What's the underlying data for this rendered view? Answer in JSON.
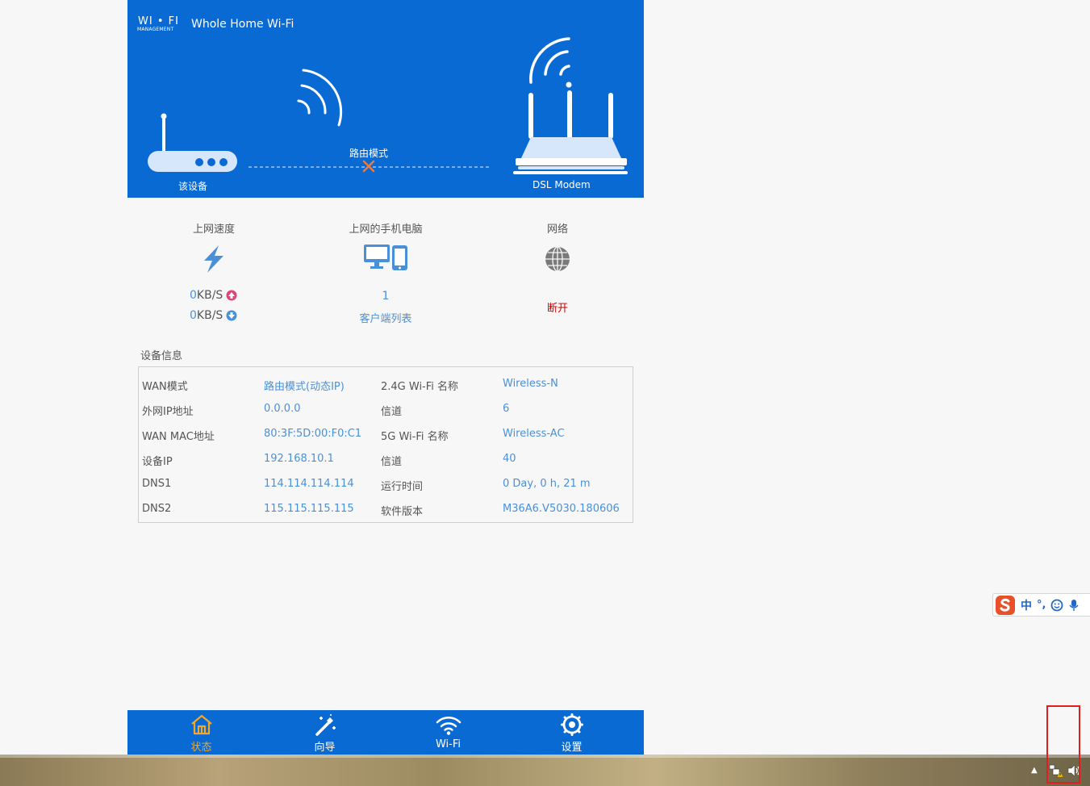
{
  "brand": {
    "logo_top": "WI • FI",
    "logo_sub": "MANAGEMENT",
    "title": "Whole Home Wi-Fi"
  },
  "topology": {
    "device_label": "该设备",
    "mode_label": "路由模式",
    "modem_label": "DSL Modem",
    "link_status": "disconnected"
  },
  "stats": {
    "speed": {
      "title": "上网速度",
      "up_value": "0",
      "down_value": "0",
      "unit": "KB/S"
    },
    "clients": {
      "title": "上网的手机电脑",
      "count": "1",
      "link": "客户端列表"
    },
    "network": {
      "title": "网络",
      "status": "断开"
    }
  },
  "device_info": {
    "title": "设备信息",
    "rows": [
      {
        "k1": "WAN模式",
        "v1": "路由模式(动态IP)",
        "k2": "2.4G Wi-Fi 名称",
        "v2": "Wireless-N"
      },
      {
        "k1": "外网IP地址",
        "v1": "0.0.0.0",
        "k2": "信道",
        "v2": "6"
      },
      {
        "k1": "WAN MAC地址",
        "v1": "80:3F:5D:00:F0:C1",
        "k2": "5G Wi-Fi 名称",
        "v2": "Wireless-AC"
      },
      {
        "k1": "设备IP",
        "v1": "192.168.10.1",
        "k2": "信道",
        "v2": "40"
      },
      {
        "k1": "DNS1",
        "v1": "114.114.114.114",
        "k2": "运行时间",
        "v2": "0 Day, 0 h, 21 m"
      },
      {
        "k1": "DNS2",
        "v1": "115.115.115.115",
        "k2": "软件版本",
        "v2": "M36A6.V5030.180606"
      }
    ]
  },
  "nav": {
    "items": [
      {
        "label": "状态",
        "icon": "home-icon",
        "active": true
      },
      {
        "label": "向导",
        "icon": "wand-icon",
        "active": false
      },
      {
        "label": "Wi-Fi",
        "icon": "wifi-icon",
        "active": false
      },
      {
        "label": "设置",
        "icon": "gear-icon",
        "active": false
      }
    ]
  },
  "ime": {
    "lang": "中",
    "punct": "°,"
  },
  "colors": {
    "primary": "#0a6ad4",
    "link": "#4a90d9",
    "active": "#f5a623",
    "error": "#cc0000",
    "upload_arrow": "#e0447a",
    "download_arrow": "#4a90d9"
  }
}
